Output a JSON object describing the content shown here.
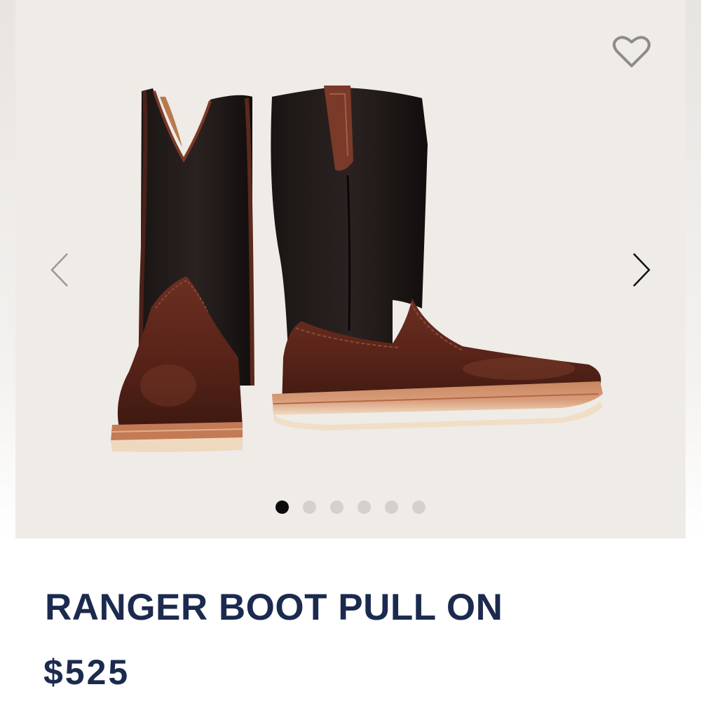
{
  "gallery": {
    "background_color": "#efebe7",
    "image_semantic": "ranger-boot-pull-on-photo",
    "slide_count": 6,
    "active_slide": 1,
    "prev_icon": "chevron-left-icon",
    "next_icon": "chevron-right-icon",
    "favorite_icon": "heart-outline-icon"
  },
  "product": {
    "title": "RANGER BOOT PULL ON",
    "price": "$525",
    "text_color": "#1b2a4e"
  }
}
